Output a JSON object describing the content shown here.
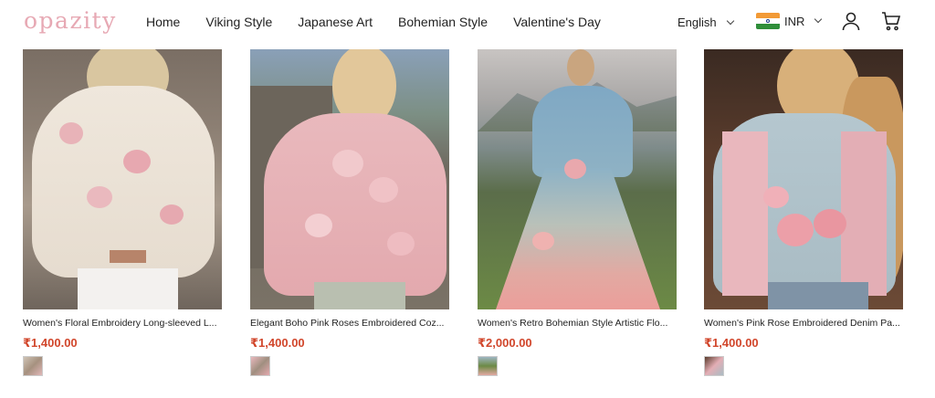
{
  "header": {
    "logo": "opazity",
    "nav": [
      "Home",
      "Viking Style",
      "Japanese Art",
      "Bohemian Style",
      "Valentine's Day"
    ],
    "language": "English",
    "currency": "INR"
  },
  "products": [
    {
      "title": "Women's Floral Embroidery Long-sleeved L...",
      "price": "₹1,400.00"
    },
    {
      "title": "Elegant Boho Pink Roses Embroidered Coz...",
      "price": "₹1,400.00"
    },
    {
      "title": "Women's Retro Bohemian Style Artistic Flo...",
      "price": "₹2,000.00"
    },
    {
      "title": "Women's Pink Rose Embroidered Denim Pa...",
      "price": "₹1,400.00"
    }
  ],
  "colors": {
    "logo": "#e7a9b4",
    "price": "#d1462b"
  }
}
